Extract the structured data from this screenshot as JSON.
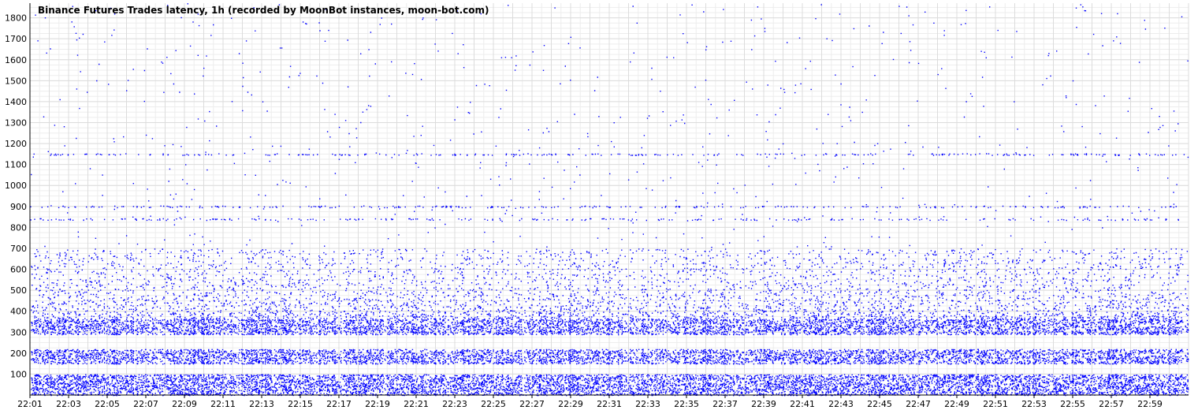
{
  "chart_data": {
    "type": "scatter",
    "title": "Binance Futures Trades latency, 1h (recorded by MoonBot instances, moon-bot.com)",
    "xlabel": "",
    "ylabel": "",
    "x_range": [
      "22:01",
      "23:00"
    ],
    "ylim": [
      0,
      1870
    ],
    "yticks": [
      100,
      200,
      300,
      400,
      500,
      600,
      700,
      800,
      900,
      1000,
      1100,
      1200,
      1300,
      1400,
      1500,
      1600,
      1700,
      1800
    ],
    "xticks": [
      "22:01",
      "22:03",
      "22:05",
      "22:07",
      "22:09",
      "22:11",
      "22:13",
      "22:15",
      "22:17",
      "22:19",
      "22:21",
      "22:23",
      "22:25",
      "22:27",
      "22:29",
      "22:31",
      "22:33",
      "22:35",
      "22:37",
      "22:39",
      "22:41",
      "22:43",
      "22:45",
      "22:47",
      "22:49",
      "22:51",
      "22:53",
      "22:55",
      "22:57",
      "22:59"
    ],
    "grid": true,
    "legend": "none",
    "series": [
      {
        "color": "#0000ff",
        "density_bands": [
          {
            "range": [
              0,
              100
            ],
            "density": "very high"
          },
          {
            "range": [
              150,
              220
            ],
            "density": "high"
          },
          {
            "range": [
              290,
              360
            ],
            "density": "high"
          },
          {
            "range": [
              360,
              700
            ],
            "density": "medium"
          },
          {
            "range": [
              700,
              1900
            ],
            "density": "sparse"
          }
        ],
        "levels": [
          840,
          900,
          1150
        ]
      }
    ]
  },
  "colors": {
    "points": "#0000ff",
    "grid": "#dcdcdc",
    "axis": "#000000",
    "background": "#ffffff"
  }
}
